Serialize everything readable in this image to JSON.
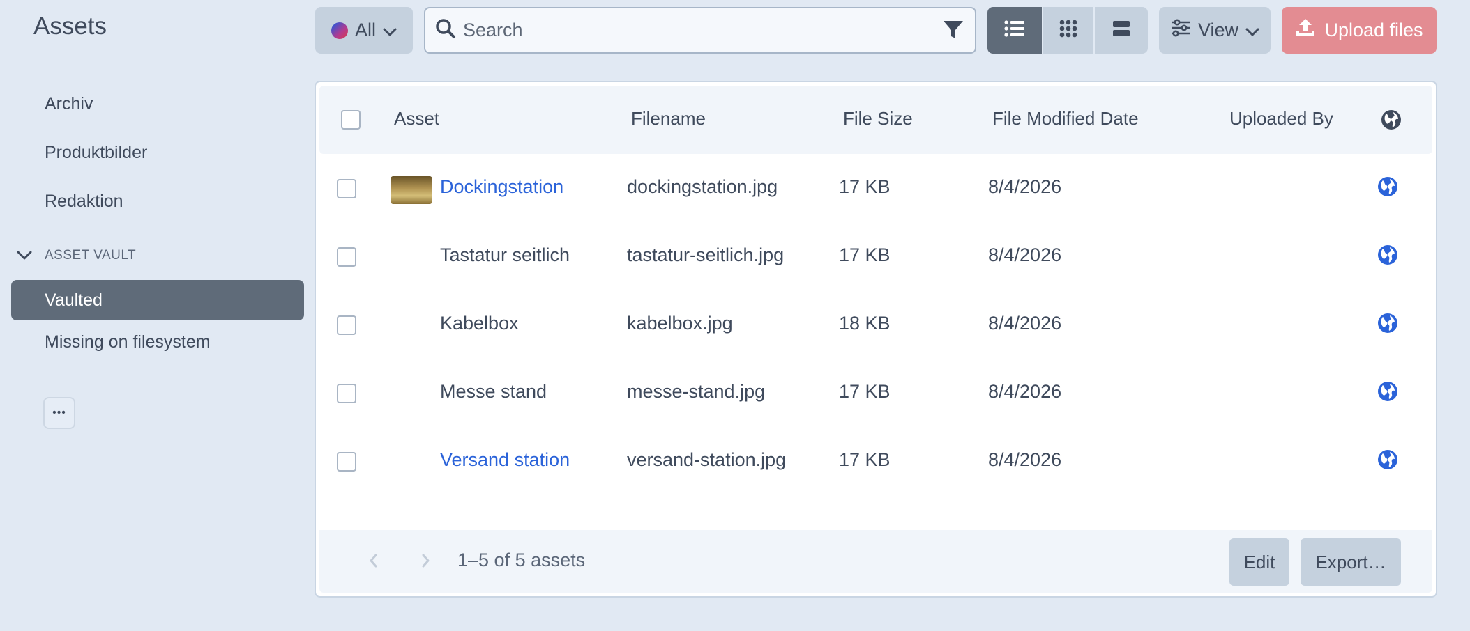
{
  "page": {
    "title": "Assets"
  },
  "sidebar": {
    "items": [
      {
        "label": "Archiv"
      },
      {
        "label": "Produktbilder"
      },
      {
        "label": "Redaktion"
      }
    ],
    "section": {
      "label": "ASSET VAULT",
      "items": [
        {
          "label": "Vaulted",
          "active": true
        },
        {
          "label": "Missing on filesystem"
        }
      ]
    },
    "more_label": "•••"
  },
  "toolbar": {
    "scope_label": "All",
    "search_placeholder": "Search",
    "view_label": "View",
    "upload_label": "Upload files"
  },
  "table": {
    "columns": [
      "Asset",
      "Filename",
      "File Size",
      "File Modified Date",
      "Uploaded By"
    ],
    "rows": [
      {
        "asset": "Dockingstation",
        "filename": "dockingstation.jpg",
        "size": "17 KB",
        "modified": "8/4/2026",
        "uploaded_by": "",
        "link": true,
        "thumb": true
      },
      {
        "asset": "Tastatur seitlich",
        "filename": "tastatur-seitlich.jpg",
        "size": "17 KB",
        "modified": "8/4/2026",
        "uploaded_by": "",
        "link": false,
        "thumb": false
      },
      {
        "asset": "Kabelbox",
        "filename": "kabelbox.jpg",
        "size": "18 KB",
        "modified": "8/4/2026",
        "uploaded_by": "",
        "link": false,
        "thumb": false
      },
      {
        "asset": "Messe stand",
        "filename": "messe-stand.jpg",
        "size": "17 KB",
        "modified": "8/4/2026",
        "uploaded_by": "",
        "link": false,
        "thumb": false
      },
      {
        "asset": "Versand station",
        "filename": "versand-station.jpg",
        "size": "17 KB",
        "modified": "8/4/2026",
        "uploaded_by": "",
        "link": true,
        "thumb": false
      }
    ]
  },
  "footer": {
    "count_text": "1–5 of 5 assets",
    "edit_label": "Edit",
    "export_label": "Export…"
  },
  "colors": {
    "accent_link": "#2b63d9",
    "active_item": "#5f6b79",
    "upload_button": "#e38c92"
  }
}
